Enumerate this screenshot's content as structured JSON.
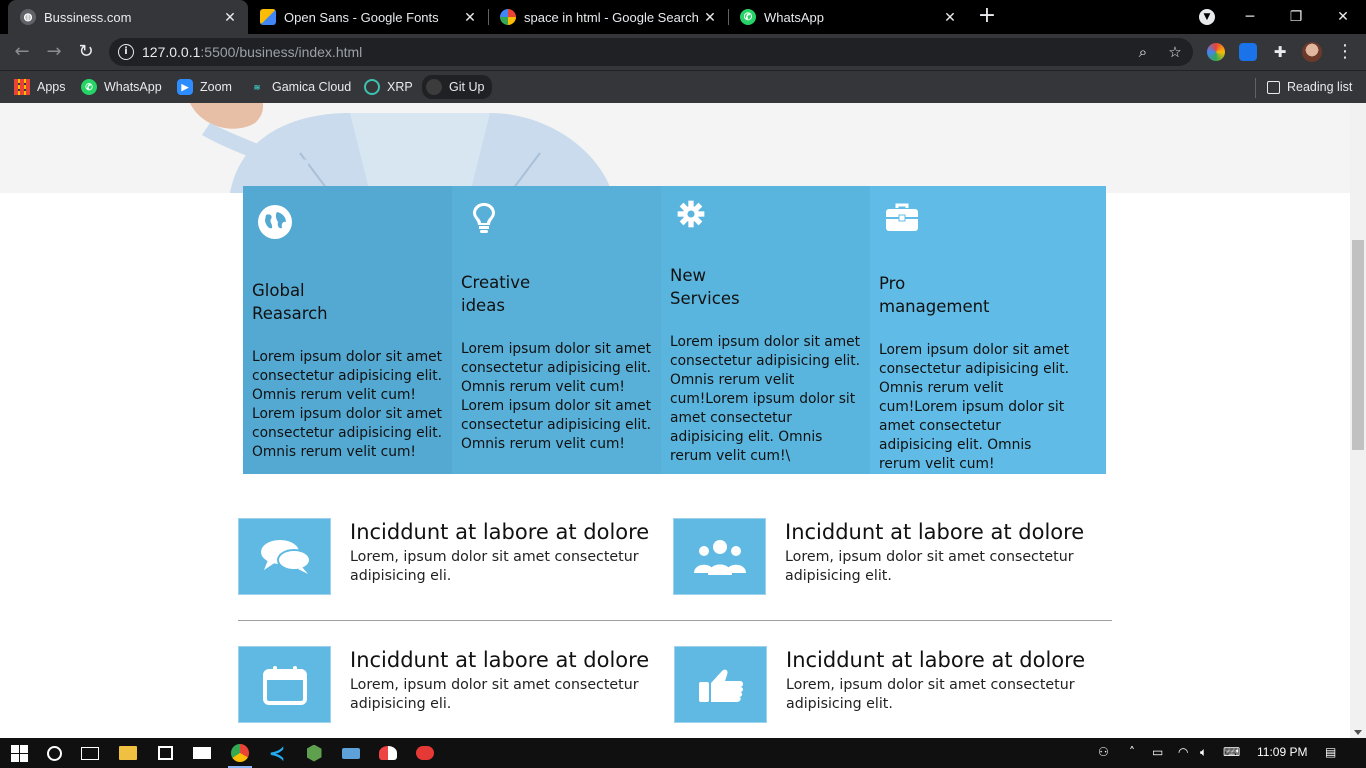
{
  "browser": {
    "tabs": [
      {
        "title": "Bussiness.com",
        "active": true
      },
      {
        "title": "Open Sans - Google Fonts",
        "active": false
      },
      {
        "title": "space in html - Google Search",
        "active": false
      },
      {
        "title": "WhatsApp",
        "active": false
      }
    ],
    "url_host": "127.0.0.1",
    "url_rest": ":5500/business/index.html",
    "bookmarks": [
      "Apps",
      "WhatsApp",
      "Zoom",
      "Gamica Cloud",
      "XRP",
      "Git Up"
    ],
    "reading_list": "Reading list"
  },
  "features": [
    {
      "title_line1": "Global",
      "title_line2": "Reasarch",
      "text": "Lorem ipsum dolor sit amet consectetur adipisicing elit. Omnis rerum velit cum! Lorem ipsum dolor sit amet consectetur adipisicing elit. Omnis rerum velit cum!",
      "icon": "globe-icon",
      "color": "#54a9d2"
    },
    {
      "title_line1": "Creative",
      "title_line2": "ideas",
      "text": "Lorem ipsum dolor sit amet consectetur adipisicing elit. Omnis rerum velit cum! Lorem ipsum dolor sit amet consectetur adipisicing elit. Omnis rerum velit cum!",
      "icon": "lightbulb-icon",
      "color": "#58b0d9"
    },
    {
      "title_line1": "New",
      "title_line2": "Services",
      "text": "Lorem ipsum dolor sit amet consectetur adipisicing elit. Omnis rerum velit cum!Lorem ipsum dolor sit amet consectetur adipisicing elit. Omnis rerum velit cum!\\",
      "icon": "gear-icon",
      "color": "#5ab5de"
    },
    {
      "title_line1": "Pro",
      "title_line2": "management",
      "text": "Lorem ipsum dolor sit amet consectetur adipisicing elit. Omnis rerum velit cum!Lorem ipsum dolor sit amet consectetur adipisicing elit. Omnis rerum velit cum!",
      "icon": "briefcase-icon",
      "color": "#60bce6"
    }
  ],
  "info_items": [
    {
      "title": "Inciddunt at labore at dolore",
      "text": "Lorem, ipsum dolor sit amet consectetur adipisicing eli.",
      "icon": "chat-bubbles-icon"
    },
    {
      "title": "Inciddunt at labore at dolore",
      "text": "Lorem, ipsum dolor sit amet consectetur adipisicing elit.",
      "icon": "people-icon"
    },
    {
      "title": "Inciddunt at labore at dolore",
      "text": "Lorem, ipsum dolor sit amet consectetur adipisicing eli.",
      "icon": "calendar-icon"
    },
    {
      "title": "Inciddunt at labore at dolore",
      "text": "Lorem, ipsum dolor sit amet consectetur adipisicing elit.",
      "icon": "thumbs-up-icon"
    }
  ],
  "taskbar": {
    "clock": "11:09 PM"
  }
}
